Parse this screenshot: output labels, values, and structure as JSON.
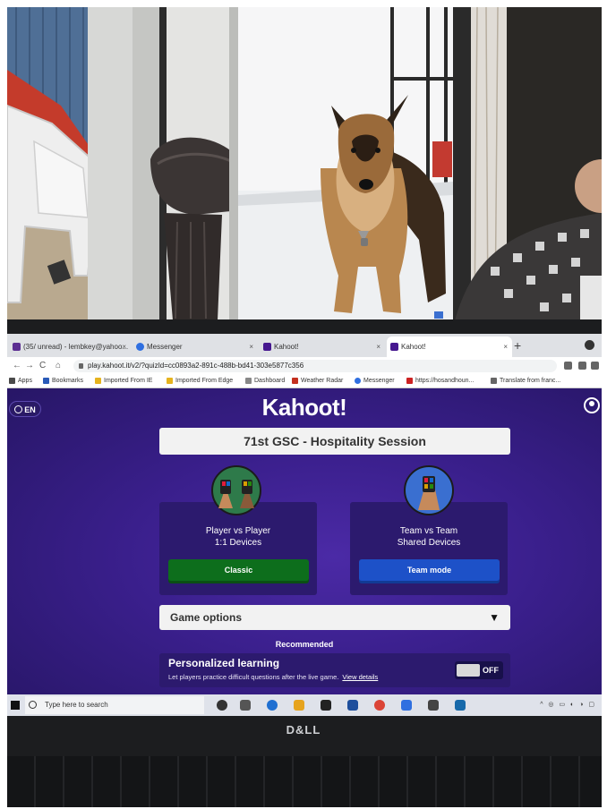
{
  "browser": {
    "tabs": [
      {
        "label": "(35/ unread) - lembkey@yahoo...",
        "favicon_color": "#5b2d91",
        "active": false
      },
      {
        "label": "Messenger",
        "favicon_color": "#2f6fe0",
        "active": false
      },
      {
        "label": "Kahoot!",
        "favicon_color": "#46178f",
        "active": false
      },
      {
        "label": "Kahoot!",
        "favicon_color": "#46178f",
        "active": true
      }
    ],
    "close_glyph": "×",
    "new_tab_glyph": "+",
    "nav": {
      "back": "←",
      "forward": "→",
      "reload": "C",
      "home": "⌂"
    },
    "url": "play.kahoot.it/v2/?quizId=cc0893a2-891c-488b-bd41-303e5877c356",
    "bookmarks": [
      {
        "label": "Apps",
        "icon_color": "#4a4a4a"
      },
      {
        "label": "Bookmarks",
        "icon_color": "#2a5ab8"
      },
      {
        "label": "Imported From IE",
        "icon_color": "#e6b31e"
      },
      {
        "label": "Imported From Edge",
        "icon_color": "#e6b31e"
      },
      {
        "label": "Dashboard",
        "icon_color": "#888888"
      },
      {
        "label": "Weather Radar",
        "icon_color": "#c4301f"
      },
      {
        "label": "Messenger",
        "icon_color": "#2f6fe0"
      },
      {
        "label": "https://hosandhoun...",
        "icon_color": "#cc2222"
      },
      {
        "label": "Translate from franc...",
        "icon_color": "#666666"
      }
    ]
  },
  "kahoot": {
    "lang": "EN",
    "logo": "Kahoot!",
    "session_title": "71st GSC - Hospitality Session",
    "modes": [
      {
        "line1": "Player vs Player",
        "line2": "1:1 Devices",
        "button": "Classic",
        "button_color": "#0d6e1c"
      },
      {
        "line1": "Team vs Team",
        "line2": "Shared Devices",
        "button": "Team mode",
        "button_color": "#1d51c8"
      }
    ],
    "game_options": "Game options",
    "game_options_arrow": "▼",
    "recommended": "Recommended",
    "personalized": {
      "title": "Personalized learning",
      "description": "Let players practice difficult questions after the live game.",
      "link": "View details",
      "toggle_state": "OFF"
    },
    "colors": {
      "background": "#3a1f8c",
      "card": "#2c1a6e"
    }
  },
  "taskbar": {
    "search_placeholder": "Type here to search",
    "app_icons": [
      "#333333",
      "#555555",
      "#1f6fd1",
      "#e6a31e",
      "#222222",
      "#1f4f9c",
      "#db4437",
      "#2f6fe0",
      "#444444",
      "#1769aa"
    ]
  },
  "laptop_brand": "D&LL"
}
